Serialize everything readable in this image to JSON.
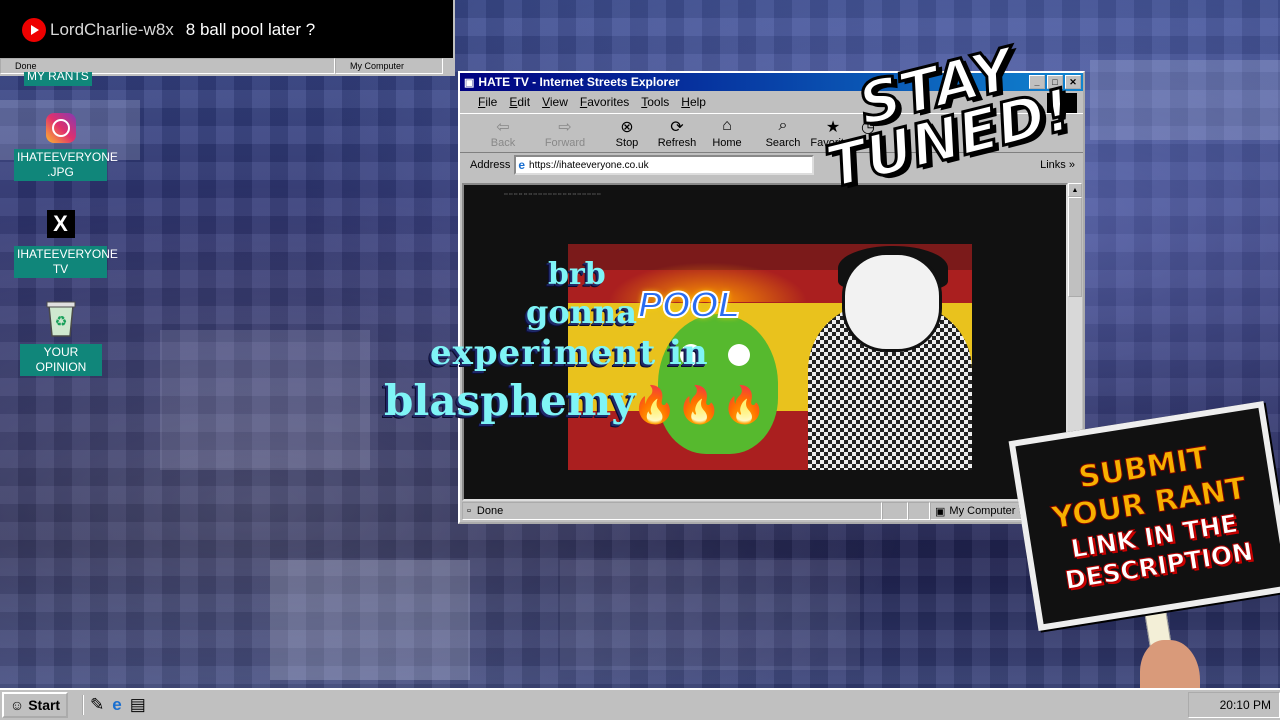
{
  "comment": {
    "username": "LordCharlie-w8x",
    "message": "8 ball pool later ?",
    "status_left": "Done",
    "status_right": "My Computer"
  },
  "desktop_icons": [
    {
      "label": "MY RANTS",
      "icon": "folder-icon"
    },
    {
      "label": "IHATEEVERYONE\n.JPG",
      "icon": "instagram-icon"
    },
    {
      "label": "IHATEEVERYONE\nTV",
      "icon": "x-icon"
    },
    {
      "label": "YOUR OPINION",
      "icon": "recycle-bin-icon"
    }
  ],
  "browser": {
    "title": "HATE TV - Internet Streets Explorer",
    "menus": [
      "File",
      "Edit",
      "View",
      "Favorites",
      "Tools",
      "Help"
    ],
    "toolbar": [
      {
        "label": "Back",
        "icon": "back-arrow-icon",
        "enabled": false
      },
      {
        "label": "Forward",
        "icon": "forward-arrow-icon",
        "enabled": false
      },
      {
        "label": "Stop",
        "icon": "stop-icon",
        "enabled": true
      },
      {
        "label": "Refresh",
        "icon": "refresh-icon",
        "enabled": true
      },
      {
        "label": "Home",
        "icon": "home-icon",
        "enabled": true
      },
      {
        "label": "Search",
        "icon": "search-icon",
        "enabled": true
      },
      {
        "label": "Favorites",
        "icon": "favorites-icon",
        "enabled": true
      },
      {
        "label": "H",
        "icon": "history-icon",
        "enabled": true
      }
    ],
    "address_label": "Address",
    "address_value": "https://ihateeveryone.co.uk",
    "links_label": "Links",
    "status_left": "Done",
    "status_right": "My Computer"
  },
  "thumbnail": {
    "title_word": "POOL"
  },
  "overlay": {
    "line1": "brb",
    "line2": "gonna",
    "line3": "experiment in",
    "line4": "blasphemy",
    "emoji": "🔥🔥🔥"
  },
  "stay_tuned": {
    "line1": "STAY",
    "line2": "TUNED!"
  },
  "sign": {
    "line1": "SUBMIT",
    "line2": "YOUR RANT",
    "line3": "LINK IN THE",
    "line4": "DESCRIPTION"
  },
  "taskbar": {
    "start_label": "Start",
    "clock": "20:10 PM"
  },
  "colors": {
    "desktop_label_bg": "#10867a",
    "title_bar": "#000080",
    "overlay_text": "#7ff4f6",
    "sign_yellow": "#f7b000"
  }
}
